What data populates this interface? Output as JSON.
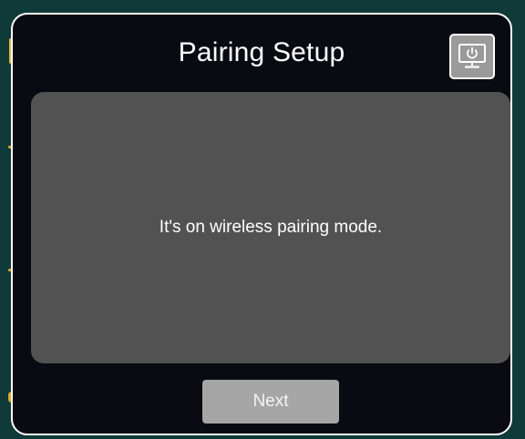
{
  "dialog": {
    "title": "Pairing Setup",
    "message": "It's on wireless pairing mode.",
    "next_label": "Next",
    "power_icon": "power-display-icon"
  },
  "colors": {
    "dialog_background": "#0a0a12",
    "panel_background": "#525252",
    "button_background": "#a6a6a6",
    "border": "#ffffff"
  }
}
